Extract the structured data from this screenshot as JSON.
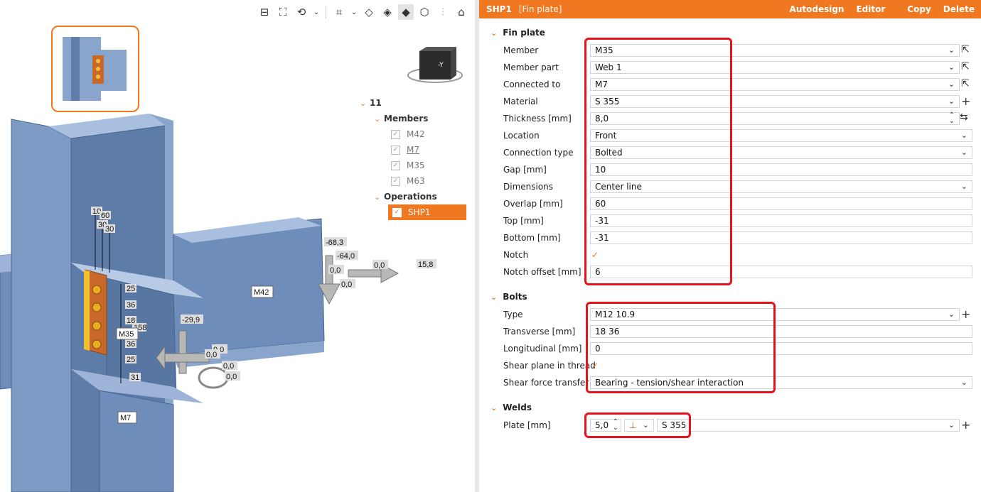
{
  "panel": {
    "title": "SHP1",
    "subtitle": "[Fin plate]",
    "actions": [
      "Autodesign",
      "Editor",
      "Copy",
      "Delete"
    ]
  },
  "sections": {
    "fin_plate": "Fin plate",
    "bolts": "Bolts",
    "welds": "Welds"
  },
  "fin_plate": {
    "member": {
      "label": "Member",
      "value": "M35"
    },
    "member_part": {
      "label": "Member part",
      "value": "Web 1"
    },
    "connected_to": {
      "label": "Connected to",
      "value": "M7"
    },
    "material": {
      "label": "Material",
      "value": "S 355"
    },
    "thickness": {
      "label": "Thickness [mm]",
      "value": "8,0"
    },
    "location": {
      "label": "Location",
      "value": "Front"
    },
    "connection_type": {
      "label": "Connection type",
      "value": "Bolted"
    },
    "gap": {
      "label": "Gap [mm]",
      "value": "10"
    },
    "dimensions": {
      "label": "Dimensions",
      "value": "Center line"
    },
    "overlap": {
      "label": "Overlap [mm]",
      "value": "60"
    },
    "top": {
      "label": "Top [mm]",
      "value": "-31"
    },
    "bottom": {
      "label": "Bottom [mm]",
      "value": "-31"
    },
    "notch": {
      "label": "Notch",
      "checked": true
    },
    "notch_offset": {
      "label": "Notch offset [mm]",
      "value": "6"
    }
  },
  "bolts": {
    "type": {
      "label": "Type",
      "value": "M12 10.9"
    },
    "transverse": {
      "label": "Transverse [mm]",
      "value": "18 36"
    },
    "longitudinal": {
      "label": "Longitudinal [mm]",
      "value": "0"
    },
    "shear_plane": {
      "label": "Shear plane in thread",
      "checked": true
    },
    "shear_force": {
      "label": "Shear force transfer",
      "value": "Bearing - tension/shear interaction"
    }
  },
  "welds": {
    "plate": {
      "label": "Plate [mm]",
      "thickness": "5,0",
      "material": "S 355"
    }
  },
  "tree": {
    "root": "11",
    "members_label": "Members",
    "members": [
      "M42",
      "M7",
      "M35",
      "M63"
    ],
    "operations_label": "Operations",
    "operations": [
      "SHP1"
    ]
  },
  "viewport": {
    "member_labels": [
      "M42",
      "M35",
      "M7"
    ],
    "dims_top": [
      "10",
      "60",
      "30",
      "30"
    ],
    "dims_side": [
      "25",
      "36",
      "18",
      "158",
      "36",
      "25",
      "31"
    ],
    "loads_right": [
      "-68,3",
      "-64,0",
      "0,0",
      "0,0",
      "0,0",
      "15,8"
    ],
    "loads_left": [
      "-29,9",
      "0,0",
      "0,0",
      "0,0",
      "0,0"
    ],
    "navcube_face": "-Y"
  },
  "colors": {
    "accent": "#f07820",
    "highlight": "#e8141c",
    "steel": "#7b9ac4",
    "plate": "#c8682a"
  }
}
